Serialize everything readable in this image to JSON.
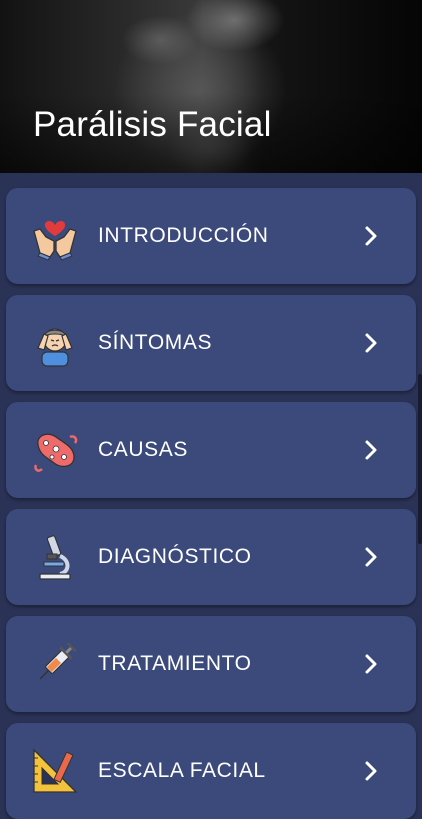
{
  "header": {
    "title": "Parálisis Facial"
  },
  "menu": {
    "items": [
      {
        "label": "INTRODUCCIÓN",
        "icon": "hands-heart-icon"
      },
      {
        "label": "SÍNTOMAS",
        "icon": "headache-person-icon"
      },
      {
        "label": "CAUSAS",
        "icon": "bacteria-icon"
      },
      {
        "label": "DIAGNÓSTICO",
        "icon": "microscope-icon"
      },
      {
        "label": "TRATAMIENTO",
        "icon": "syringe-icon"
      },
      {
        "label": "ESCALA FACIAL",
        "icon": "set-square-pencil-icon"
      }
    ]
  },
  "colors": {
    "background": "#2a3256",
    "card": "#3b4a7b",
    "text": "#ffffff"
  }
}
